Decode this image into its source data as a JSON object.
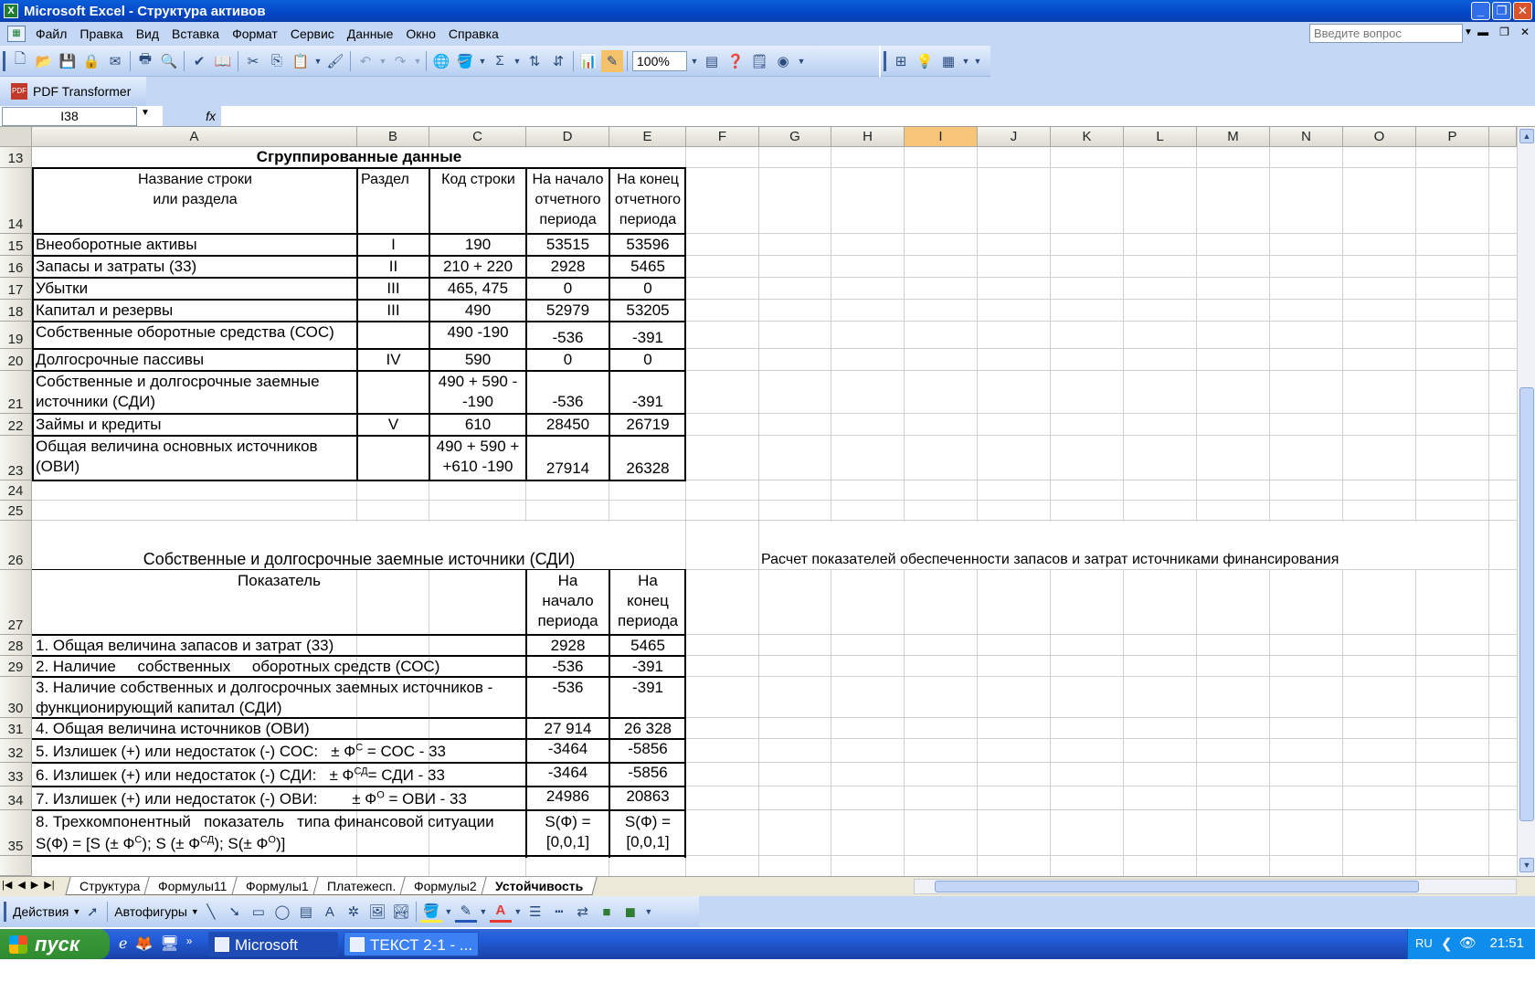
{
  "window": {
    "title": "Microsoft Excel - Структура активов"
  },
  "menu": [
    "Файл",
    "Правка",
    "Вид",
    "Вставка",
    "Формат",
    "Сервис",
    "Данные",
    "Окно",
    "Справка"
  ],
  "help_placeholder": "Введите вопрос",
  "zoom": "100%",
  "pdf_toolbar": "PDF Transformer",
  "name_box": "I38",
  "fx": "fx",
  "columns": [
    "A",
    "B",
    "C",
    "D",
    "E",
    "F",
    "G",
    "H",
    "I",
    "J",
    "K",
    "L",
    "M",
    "N",
    "O",
    "P"
  ],
  "selected_column": "I",
  "rows": [
    "13",
    "14",
    "15",
    "16",
    "17",
    "18",
    "19",
    "20",
    "21",
    "22",
    "23",
    "24",
    "25",
    "26",
    "27",
    "28",
    "29",
    "30",
    "31",
    "32",
    "33",
    "34",
    "35"
  ],
  "table1": {
    "title": "Сгруппированные данные",
    "headers": {
      "name_line1": "Название строки",
      "name_line2": "или раздела",
      "section": "Раздел",
      "code": "Код строки",
      "start": [
        "На начало",
        "отчетного",
        "периода"
      ],
      "end": [
        "На конец",
        "отчетного",
        "периода"
      ]
    },
    "rows": [
      {
        "name": "Внеоборотные активы",
        "section": "I",
        "code": "190",
        "start": "53515",
        "end": "53596"
      },
      {
        "name": "Запасы и затраты (33)",
        "section": "II",
        "code": "210 + 220",
        "start": "2928",
        "end": "5465"
      },
      {
        "name": "Убытки",
        "section": "III",
        "code": "465, 475",
        "start": "0",
        "end": "0"
      },
      {
        "name": "Капитал и резервы",
        "section": "III",
        "code": "490",
        "start": "52979",
        "end": "53205"
      },
      {
        "name": "Собственные оборотные средства (СОС)",
        "section": "",
        "code": "490 -190",
        "start": "-536",
        "end": "-391"
      },
      {
        "name": "Долгосрочные пассивы",
        "section": "IV",
        "code": "590",
        "start": "0",
        "end": "0"
      },
      {
        "name_l1": "Собственные и долгосрочные заемные",
        "name_l2": "источники (СДИ)",
        "section": "",
        "code_l1": "490 + 590 -",
        "code_l2": "-190",
        "start": "-536",
        "end": "-391"
      },
      {
        "name": "Займы и кредиты",
        "section": "V",
        "code": "610",
        "start": "28450",
        "end": "26719"
      },
      {
        "name_l1": "Общая величина основных источников",
        "name_l2": "(ОВИ)",
        "section": "",
        "code_l1": "490 + 590 +",
        "code_l2": "+610 -190",
        "start": "27914",
        "end": "26328"
      }
    ]
  },
  "table2": {
    "title": "Собственные и долгосрочные заемные источники (СДИ)",
    "side_title": "Расчет показателей обеспеченности запасов и затрат источниками финансирования",
    "headers": {
      "indicator": "Показатель",
      "start": [
        "На",
        "начало",
        "периода"
      ],
      "end": [
        "На",
        "конец",
        "периода"
      ]
    },
    "rows": {
      "r28": {
        "name": "1. Общая величина запасов и затрат (33)",
        "start": "2928",
        "end": "5465"
      },
      "r29": {
        "name": "2. Наличие     собственных     оборотных средств (СОС)",
        "start": "-536",
        "end": "-391"
      },
      "r30": {
        "name_l1": "3. Наличие собственных и долгосрочных заемных источников -",
        "name_l2": "функционирующий капитал (СДИ)",
        "start": "-536",
        "end": "-391"
      },
      "r31": {
        "name": "4. Общая величина источников (ОВИ)",
        "start": "27 914",
        "end": "26 328"
      },
      "r32": {
        "name": "5. Излишек (+) или недостаток (-) СОС:",
        "formula_pre": "± Ф",
        "sup": "С",
        "formula_post": " = СОС - 33",
        "start": "-3464",
        "end": "-5856"
      },
      "r33": {
        "name": "6. Излишек (+) или недостаток (-) СДИ:",
        "formula_pre": "± Ф",
        "sup": "СД",
        "formula_post": "= СДИ - 33",
        "start": "-3464",
        "end": "-5856"
      },
      "r34": {
        "name": "7. Излишек (+) или недостаток (-) ОВИ:",
        "formula_pre": "± Ф",
        "sup": "О",
        "formula_post": " = ОВИ - 33",
        "start": "24986",
        "end": "20863"
      },
      "r35": {
        "name_l1": "8. Трехкомпонентный   показатель   типа финансовой ситуации",
        "name_l2_a": "S(Ф) = [S (± Ф",
        "sup1": "С",
        "name_l2_b": "); S (± Ф",
        "sup2": "СД",
        "name_l2_c": "); S(± Ф",
        "sup3": "О",
        "name_l2_d": ")]",
        "start_l1": "S(Ф) =",
        "start_l2": "[0,0,1]",
        "end_l1": "S(Ф) =",
        "end_l2": "[0,0,1]"
      }
    }
  },
  "sheet_tabs": [
    "Структура",
    "Формулы11",
    "Формулы1",
    "Платежесп.",
    "Формулы2",
    "Устойчивость"
  ],
  "active_tab": "Устойчивость",
  "draw_toolbar": {
    "actions": "Действия",
    "autoshapes": "Автофигуры"
  },
  "taskbar": {
    "start": "пуск",
    "tasks": [
      "Microsoft Exc...",
      "ТЕКСТ 2-1 - ..."
    ],
    "lang": "RU",
    "clock": "21:51"
  }
}
